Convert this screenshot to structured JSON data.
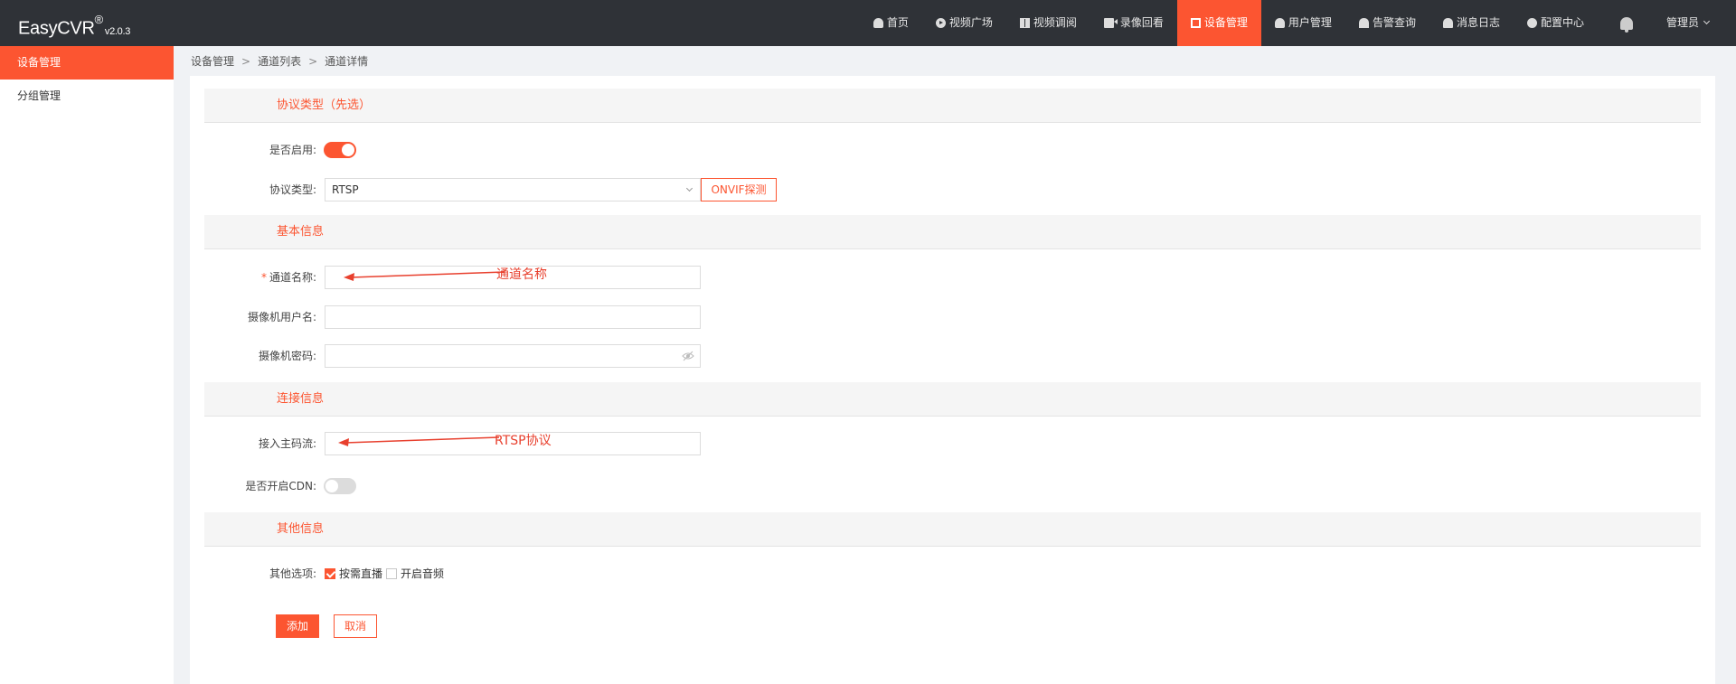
{
  "app": {
    "name": "EasyCVR",
    "reg": "®",
    "version": "v2.0.3"
  },
  "nav": {
    "items": [
      {
        "label": "首页",
        "icon": "home-icon"
      },
      {
        "label": "视频广场",
        "icon": "play-icon"
      },
      {
        "label": "视频调阅",
        "icon": "grid-icon"
      },
      {
        "label": "录像回看",
        "icon": "camera-icon"
      },
      {
        "label": "设备管理",
        "icon": "device-icon",
        "active": true
      },
      {
        "label": "用户管理",
        "icon": "user-icon"
      },
      {
        "label": "告警查询",
        "icon": "alarm-icon"
      },
      {
        "label": "消息日志",
        "icon": "bell-icon"
      },
      {
        "label": "配置中心",
        "icon": "gear-icon"
      }
    ],
    "admin_label": "管理员"
  },
  "sidebar": {
    "items": [
      {
        "label": "设备管理",
        "active": true
      },
      {
        "label": "分组管理"
      }
    ]
  },
  "breadcrumb": {
    "items": [
      "设备管理",
      "通道列表",
      "通道详情"
    ],
    "separator": ">"
  },
  "form": {
    "sections": {
      "protocol": "协议类型（先选）",
      "basic": "基本信息",
      "connection": "连接信息",
      "other": "其他信息"
    },
    "enable_label": "是否启用:",
    "enable_on": true,
    "protocol_label": "协议类型:",
    "protocol_value": "RTSP",
    "onvif_button": "ONVIF探测",
    "required_mark": "*",
    "channel_name_label": "通道名称:",
    "channel_name_value": "",
    "camera_user_label": "摄像机用户名:",
    "camera_user_value": "",
    "camera_pass_label": "摄像机密码:",
    "camera_pass_value": "",
    "main_stream_label": "接入主码流:",
    "main_stream_value": "",
    "cdn_label": "是否开启CDN:",
    "cdn_on": false,
    "other_label": "其他选项:",
    "options": [
      {
        "label": "按需直播",
        "checked": true
      },
      {
        "label": "开启音频",
        "checked": false
      }
    ],
    "add_button": "添加",
    "cancel_button": "取消"
  },
  "annotations": {
    "channel_name": "通道名称",
    "rtsp": "RTSP协议"
  },
  "colors": {
    "accent": "#fc5531",
    "topbar": "#2f3237",
    "annotation": "#e8402e"
  }
}
